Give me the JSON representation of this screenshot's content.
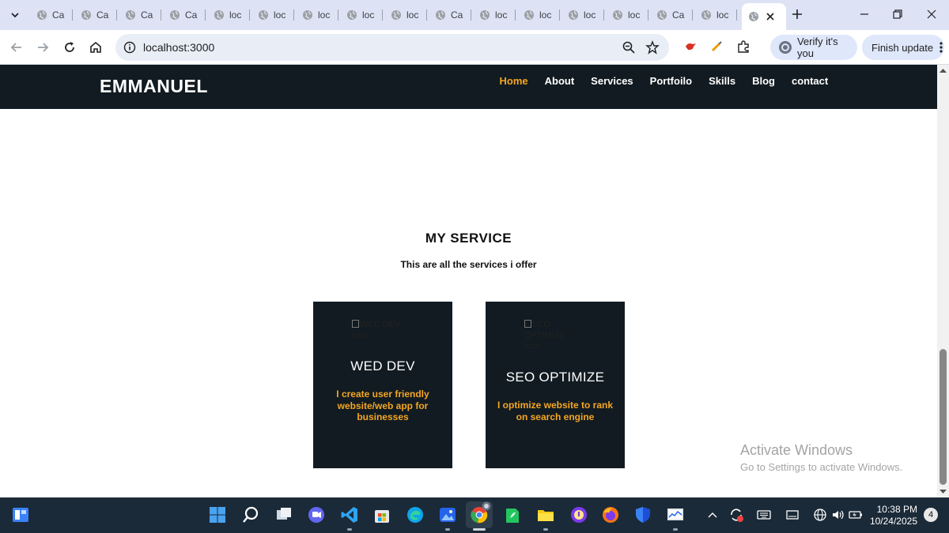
{
  "browser": {
    "tabs": [
      {
        "label": "Ca"
      },
      {
        "label": "Ca"
      },
      {
        "label": "Ca"
      },
      {
        "label": "Ca"
      },
      {
        "label": "loc"
      },
      {
        "label": "loc"
      },
      {
        "label": "loc"
      },
      {
        "label": "loc"
      },
      {
        "label": "loc"
      },
      {
        "label": "Ca"
      },
      {
        "label": "loc"
      },
      {
        "label": "loc"
      },
      {
        "label": "loc"
      },
      {
        "label": "loc"
      },
      {
        "label": "Ca"
      },
      {
        "label": "loc"
      }
    ],
    "url": "localhost:3000",
    "verify_label": "Verify it's you",
    "finish_update_label": "Finish update"
  },
  "site": {
    "brand": "EMMANUEL",
    "nav": [
      {
        "label": "Home",
        "active": true
      },
      {
        "label": "About"
      },
      {
        "label": "Services"
      },
      {
        "label": "Portfoilo"
      },
      {
        "label": "Skills"
      },
      {
        "label": "Blog"
      },
      {
        "label": "contact"
      }
    ],
    "section_title": "MY SERVICE",
    "section_subtitle": "This are all the services i offer",
    "cards": [
      {
        "img_alt": "WED DEV icon",
        "title": "WED DEV",
        "description": "I create user friendly website/web app for businesses"
      },
      {
        "img_alt": "SEO OPTIMIZE icon",
        "title": "SEO OPTIMIZE",
        "description": "I optimize website to rank on search engine"
      }
    ],
    "accent_color": "#f5a623",
    "nav_background": "#111b21"
  },
  "watermark": {
    "line1": "Activate Windows",
    "line2": "Go to Settings to activate Windows."
  },
  "taskbar": {
    "time": "10:38 PM",
    "date": "10/24/2025",
    "notification_count": "4"
  }
}
